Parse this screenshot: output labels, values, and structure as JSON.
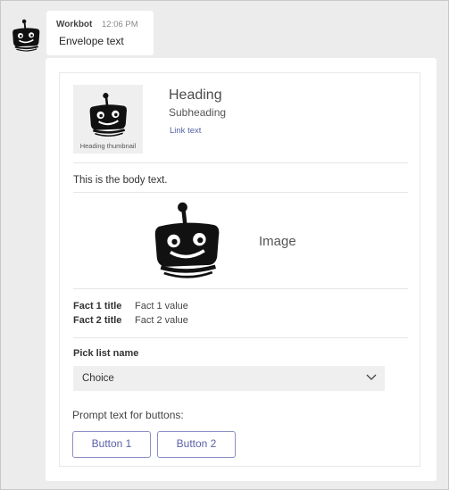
{
  "envelope": {
    "sender": "Workbot",
    "time": "12:06 PM",
    "text": "Envelope text"
  },
  "card": {
    "thumbnail_caption": "Heading thumbnail",
    "heading": "Heading",
    "subheading": "Subheading",
    "link_text": "Link text",
    "body_text": "This is the body text.",
    "image_label": "Image",
    "facts": [
      {
        "title": "Fact 1 title",
        "value": "Fact 1 value"
      },
      {
        "title": "Fact 2 title",
        "value": "Fact 2 value"
      }
    ],
    "pick_list": {
      "name": "Pick list name",
      "selected": "Choice"
    },
    "prompt_text": "Prompt text for buttons:",
    "buttons": [
      {
        "label": "Button 1"
      },
      {
        "label": "Button 2"
      }
    ]
  },
  "icons": {
    "avatar": "robot-icon",
    "thumbnail": "robot-icon",
    "image": "robot-icon",
    "dropdown": "chevron-down-icon"
  },
  "colors": {
    "background": "#ececec",
    "card": "#ffffff",
    "link": "#5563a8",
    "button_border": "#8b8fc4",
    "button_text": "#5b62a8"
  }
}
